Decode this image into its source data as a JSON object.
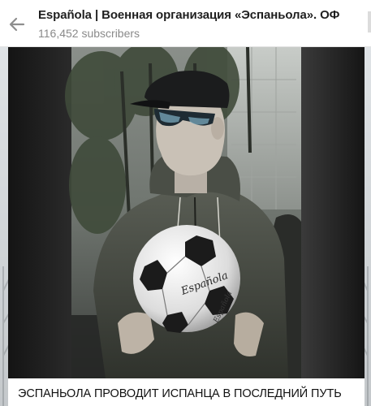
{
  "header": {
    "title": "Española | Военная организация «Эспаньола». ОФ",
    "subscribers": "116,452 subscribers",
    "back_icon": "arrow-left-icon"
  },
  "post": {
    "caption": "ЭСПАНЬОЛА ПРОВОДИТ ИСПАНЦА В ПОСЛЕДНИЙ ПУТЬ",
    "photo_text": {
      "ball_signature": "Española"
    }
  },
  "colors": {
    "header_bg": "#ffffff",
    "title_text": "#1f1f1f",
    "subtitle_text": "#8a8a8a",
    "chat_bg": "#d5d9dc"
  }
}
